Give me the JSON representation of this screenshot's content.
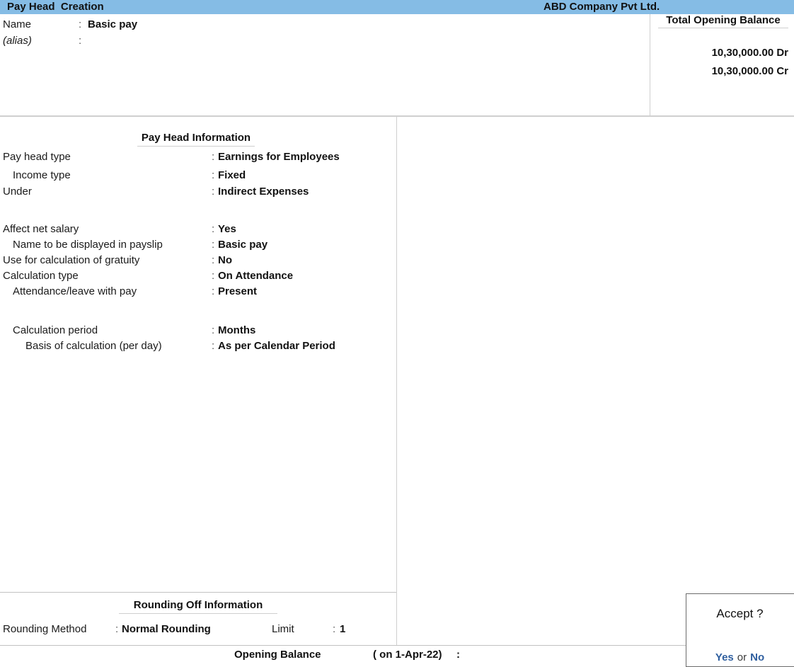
{
  "titlebar": {
    "screen_title": "Pay Head  Creation",
    "company_name": "ABD Company Pvt Ltd."
  },
  "header_form": {
    "name_label": "Name",
    "name_colon": ":",
    "name_value": "Basic pay",
    "alias_label": "(alias)",
    "alias_colon": ":",
    "alias_value": ""
  },
  "total_opening_balance": {
    "title": "Total Opening Balance",
    "debit": "10,30,000.00 Dr",
    "credit": "10,30,000.00 Cr"
  },
  "pay_head_information": {
    "title": "Pay Head Information",
    "rows": [
      {
        "label": "Pay head type",
        "colon": ":",
        "value": "Earnings for Employees",
        "indent": "root"
      },
      {
        "label": "Income type",
        "colon": ":",
        "value": "Fixed",
        "indent": "indent1"
      },
      {
        "label": "Under",
        "colon": ":",
        "value": "Indirect Expenses",
        "indent": "root"
      },
      {
        "label": "Affect net salary",
        "colon": ":",
        "value": "Yes",
        "indent": "root"
      },
      {
        "label": "Name to be displayed in payslip",
        "colon": ":",
        "value": "Basic pay",
        "indent": "indent1"
      },
      {
        "label": "Use for calculation of gratuity",
        "colon": ":",
        "value": "No",
        "indent": "root"
      },
      {
        "label": "Calculation type",
        "colon": ":",
        "value": "On Attendance",
        "indent": "root"
      },
      {
        "label": "Attendance/leave with pay",
        "colon": ":",
        "value": "Present",
        "indent": "indent1"
      },
      {
        "label": "Calculation period",
        "colon": ":",
        "value": "Months",
        "indent": "indent1"
      },
      {
        "label": "Basis of calculation (per day)",
        "colon": ":",
        "value": "As per Calendar Period",
        "indent": "indent2"
      }
    ]
  },
  "rounding_off_information": {
    "title": "Rounding Off Information",
    "method_label": "Rounding Method",
    "method_colon": ":",
    "method_value": "Normal Rounding",
    "limit_label": "Limit",
    "limit_colon": ":",
    "limit_value": "1"
  },
  "opening_balance_bar": {
    "label": "Opening Balance",
    "date": "( on 1-Apr-22)",
    "colon": ":"
  },
  "accept_dialog": {
    "title": "Accept ?",
    "yes_label": "Yes",
    "or_label": "or",
    "no_label": "No",
    "link_color": "#2f5f9f"
  },
  "colors": {
    "titlebar_background": "#85bce5",
    "page_background": "#ffffff",
    "divider": "#cfcfcf",
    "text": "#1a1a1a"
  }
}
